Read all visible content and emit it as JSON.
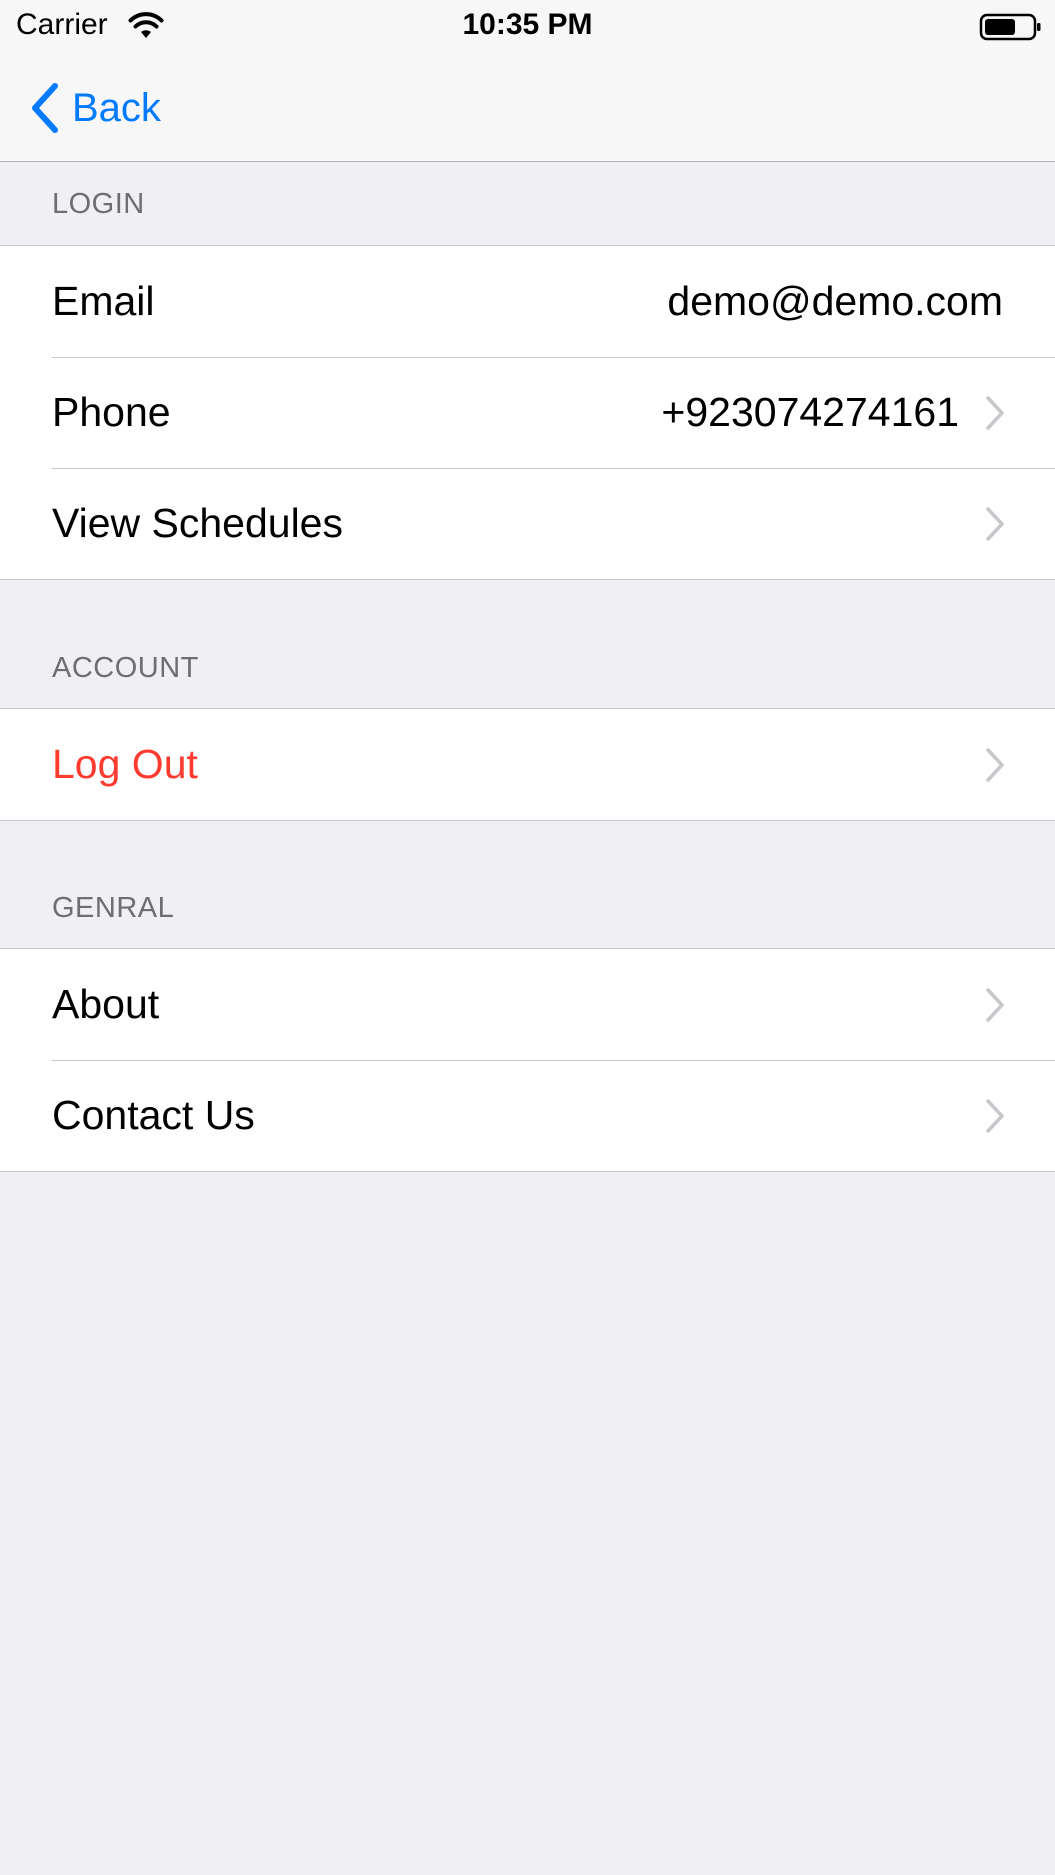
{
  "status_bar": {
    "carrier": "Carrier",
    "time": "10:35 PM",
    "wifi_icon": "wifi-icon",
    "battery_icon": "battery-icon"
  },
  "nav": {
    "back_label": "Back",
    "back_icon": "chevron-left-icon"
  },
  "sections": {
    "login": {
      "header": "LOGIN",
      "rows": [
        {
          "label": "Email",
          "value": "demo@demo.com"
        },
        {
          "label": "Phone",
          "value": "+923074274161"
        },
        {
          "label": "View Schedules"
        }
      ]
    },
    "account": {
      "header": "ACCOUNT",
      "rows": [
        {
          "label": "Log Out"
        }
      ]
    },
    "general": {
      "header": "GENRAL",
      "rows": [
        {
          "label": "About"
        },
        {
          "label": "Contact Us"
        }
      ]
    }
  },
  "colors": {
    "accent": "#007aff",
    "destructive": "#ff3b30",
    "background": "#efeff4",
    "chevron": "#c7c7cc",
    "section_header": "#6d6d72"
  }
}
